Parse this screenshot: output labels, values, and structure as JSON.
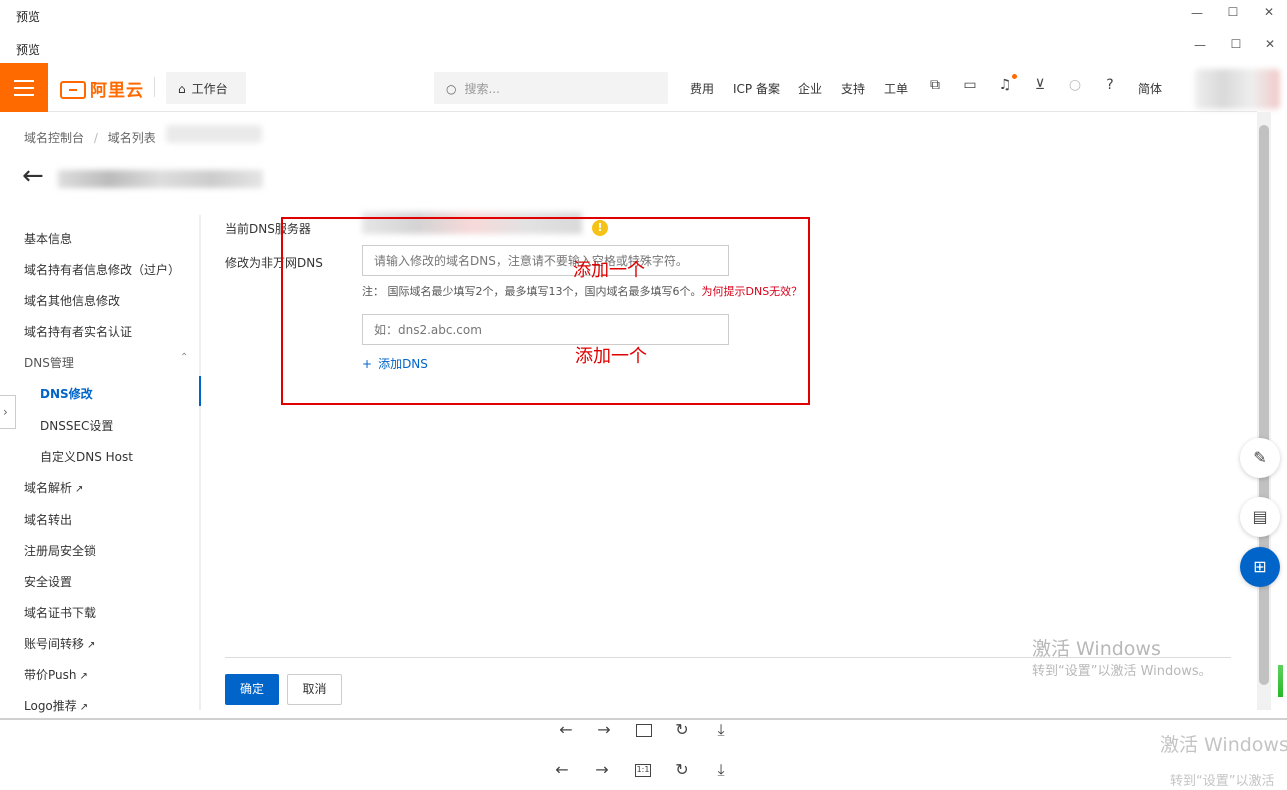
{
  "outer_window": {
    "title": "预览",
    "minimize": "—",
    "maximize": "☐",
    "close": "✕"
  },
  "inner_window": {
    "title": "预览",
    "minimize": "—",
    "maximize": "☐",
    "close": "✕"
  },
  "header": {
    "brand_color": "#ff6a00",
    "logo_text": "阿里云",
    "workbench_label": "工作台",
    "search_placeholder": "搜索...",
    "nav_links": [
      "费用",
      "ICP 备案",
      "企业",
      "支持",
      "工单"
    ],
    "language_label": "简体",
    "icons": [
      "terminal-icon",
      "bell-icon",
      "cart-icon",
      "lightbulb-icon",
      "help-icon"
    ]
  },
  "breadcrumb": {
    "items": [
      "域名控制台",
      "域名列表"
    ],
    "separator": "/"
  },
  "sidebar": {
    "accent_color": "#0064c8",
    "items": [
      {
        "label": "基本信息"
      },
      {
        "label": "域名持有者信息修改（过户）"
      },
      {
        "label": "域名其他信息修改"
      },
      {
        "label": "域名持有者实名认证"
      },
      {
        "label": "DNS管理"
      },
      {
        "label": "DNS修改"
      },
      {
        "label": "DNSSEC设置"
      },
      {
        "label": "自定义DNS Host"
      },
      {
        "label": "域名解析"
      },
      {
        "label": "域名转出"
      },
      {
        "label": "注册局安全锁"
      },
      {
        "label": "安全设置"
      },
      {
        "label": "域名证书下载"
      },
      {
        "label": "账号间转移"
      },
      {
        "label": "带价Push"
      },
      {
        "label": "Logo推荐"
      }
    ]
  },
  "form": {
    "current_dns_label": "当前DNS服务器",
    "modify_label": "修改为非万网DNS",
    "dns1_placeholder": "请输入修改的域名DNS，注意请不要输入空格或特殊字符。",
    "dns2_placeholder": "如：dns2.abc.com",
    "note_text": "注： 国际域名最少填写2个，最多填写13个，国内域名最多填写6个。",
    "note_link": "为何提示DNS无效？",
    "add_dns_label": "添加DNS",
    "add_dns_plus": "+"
  },
  "annotations": {
    "box_color": "#e00000",
    "text1": "添加一个",
    "text2": "添加一个"
  },
  "buttons": {
    "confirm": "确定",
    "cancel": "取消"
  },
  "watermark": {
    "line1": "激活 Windows",
    "line2": "转到“设置”以激活 Windows。",
    "line3": "激活 Windows",
    "line4": "转到“设置”以激活"
  },
  "viewer_toolbar": {
    "ratio_label": "1:1"
  }
}
